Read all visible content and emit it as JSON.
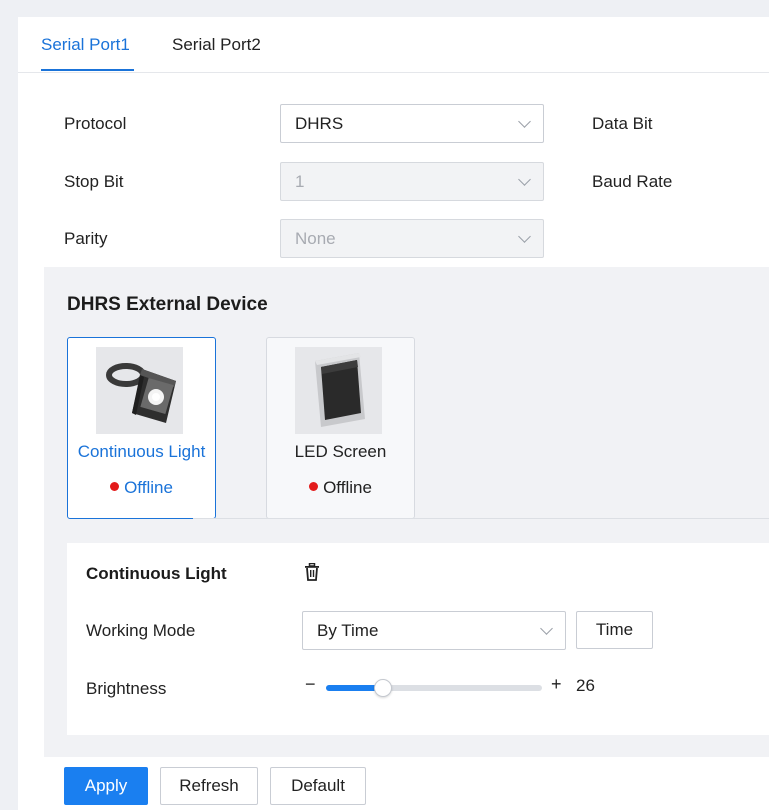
{
  "tabs": [
    {
      "label": "Serial Port1",
      "active": true
    },
    {
      "label": "Serial Port2",
      "active": false
    }
  ],
  "form": {
    "protocol": {
      "label": "Protocol",
      "value": "DHRS"
    },
    "stop_bit": {
      "label": "Stop Bit",
      "value": "1",
      "disabled": true
    },
    "parity": {
      "label": "Parity",
      "value": "None",
      "disabled": true
    },
    "data_bit": {
      "label": "Data Bit"
    },
    "baud_rate": {
      "label": "Baud Rate"
    }
  },
  "devices": {
    "title": "DHRS External Device",
    "items": [
      {
        "name": "Continuous Light",
        "status": "Offline",
        "selected": true,
        "icon": "continuous-light-device-icon"
      },
      {
        "name": "LED Screen",
        "status": "Offline",
        "selected": false,
        "icon": "led-screen-device-icon"
      }
    ]
  },
  "detail": {
    "title": "Continuous Light",
    "delete_icon": "trash-icon",
    "working_mode": {
      "label": "Working Mode",
      "value": "By Time",
      "time_button": "Time"
    },
    "brightness": {
      "label": "Brightness",
      "value": 26,
      "value_text": "26",
      "min": 0,
      "max": 100,
      "minus": "−",
      "plus": "+"
    }
  },
  "actions": {
    "apply": "Apply",
    "refresh": "Refresh",
    "default": "Default"
  },
  "colors": {
    "accent": "#1a73d9",
    "primary_button": "#1a7ff0",
    "offline_dot": "#e31b1b"
  }
}
